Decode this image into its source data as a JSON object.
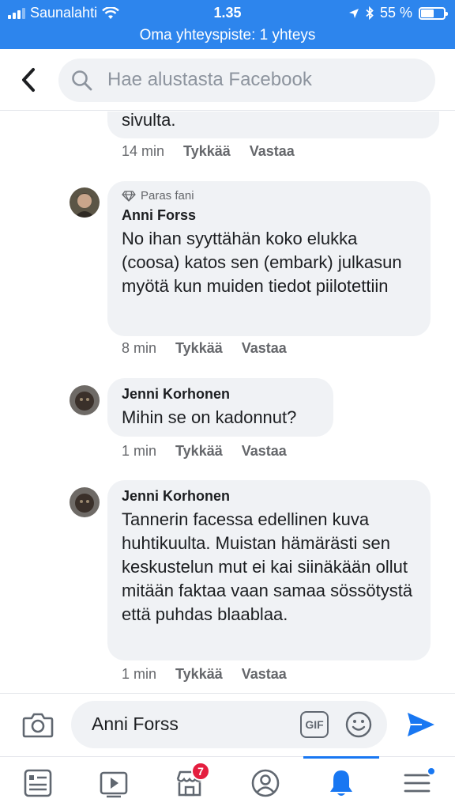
{
  "status_bar": {
    "carrier": "Saunalahti",
    "time": "1.35",
    "battery_text": "55 %",
    "battery_level": 0.55,
    "hotspot": "Oma yhteyspiste: 1 yhteys"
  },
  "header": {
    "search_placeholder": "Hae alustasta Facebook"
  },
  "comments": [
    {
      "text": "sivulta.",
      "time": "14 min",
      "like": "Tykkää",
      "reply": "Vastaa"
    },
    {
      "badge": "Paras fani",
      "author": "Anni Forss",
      "text": "No ihan syyttähän koko elukka (coosa) katos sen (embark) julkasun myötä kun muiden tiedot piilotettiin",
      "time": "8 min",
      "like": "Tykkää",
      "reply": "Vastaa"
    },
    {
      "author": "Jenni Korhonen",
      "text": "Mihin se on kadonnut?",
      "time": "1 min",
      "like": "Tykkää",
      "reply": "Vastaa"
    },
    {
      "author": "Jenni Korhonen",
      "text": "Tannerin facessa edellinen kuva huhtikuulta. Muistan hämärästi sen keskustelun mut ei kai siinäkään ollut mitään faktaa vaan samaa sössötystä että puhdas blaablaa.",
      "time": "1 min",
      "like": "Tykkää",
      "reply": "Vastaa"
    }
  ],
  "composer": {
    "value": "Anni Forss",
    "gif_label": "GIF"
  },
  "nav": {
    "marketplace_badge": "7",
    "active": "notifications"
  },
  "colors": {
    "status_bar": "#2d85ed",
    "accent": "#1877f2",
    "badge": "#e41e3f"
  }
}
